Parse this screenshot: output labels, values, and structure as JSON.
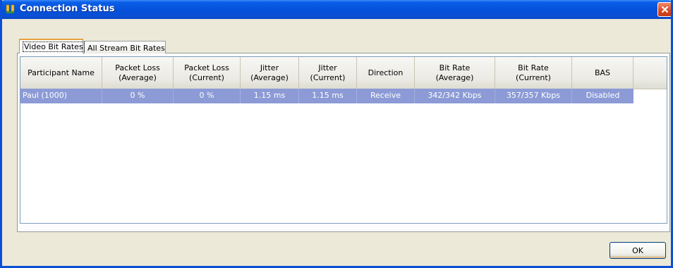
{
  "window": {
    "title": "Connection Status",
    "title_icon": "network-icon",
    "close_icon": "close-icon",
    "accent_color": "#0a4fd6"
  },
  "tabs": [
    {
      "label": "Video Bit Rates",
      "selected": true
    },
    {
      "label": "All Stream Bit Rates",
      "selected": false
    }
  ],
  "table": {
    "columns": [
      "Participant Name",
      "Packet Loss\n(Average)",
      "Packet Loss\n(Current)",
      "Jitter\n(Average)",
      "Jitter\n(Current)",
      "Direction",
      "Bit Rate\n(Average)",
      "Bit Rate\n(Current)",
      "BAS"
    ],
    "rows": [
      [
        "Paul (1000)",
        "0 %",
        "0 %",
        "1.15 ms",
        "1.15 ms",
        "Receive",
        "342/342 Kbps",
        "357/357 Kbps",
        "Disabled"
      ]
    ],
    "selected_row_color": "#8c9bd6"
  },
  "buttons": {
    "ok_label": "OK"
  }
}
